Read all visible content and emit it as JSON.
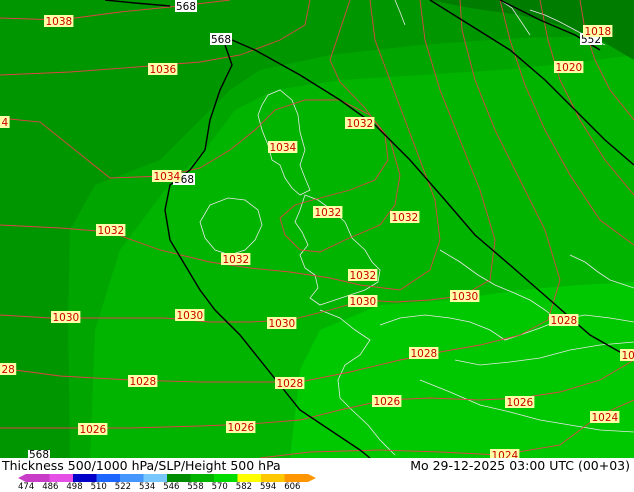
{
  "footer": {
    "title_left": "Thickness 500/1000 hPa/SLP/Height 500 hPa",
    "title_right": "Mo 29-12-2025 03:00 UTC (00+03)",
    "scale_ticks": [
      "474",
      "486",
      "498",
      "510",
      "522",
      "534",
      "546",
      "558",
      "570",
      "582",
      "594",
      "606"
    ],
    "scale_colors": [
      "#c83cc8",
      "#e650e6",
      "#0000c8",
      "#1e64ff",
      "#4696ff",
      "#78c8ff",
      "#008c00",
      "#00b400",
      "#00dc00",
      "#ffff00",
      "#ffc800",
      "#ff9600"
    ]
  },
  "colors": {
    "fill_dark": "#009600",
    "fill_mid": "#00a500",
    "fill_light": "#00b400",
    "fill_bright": "#00c800",
    "fill_darkest": "#007d00",
    "isobar": "#dc4646",
    "coast": "#e8e8e8",
    "height_line": "#000000"
  },
  "pressure_labels": [
    {
      "name": "label-1038",
      "text": "1038"
    },
    {
      "name": "label-1036",
      "text": "1036"
    },
    {
      "name": "label-edge-left",
      "text": "4"
    },
    {
      "name": "label-1034-west",
      "text": "1034"
    },
    {
      "name": "label-1034-scotland",
      "text": "1034"
    },
    {
      "name": "label-1032-north",
      "text": "1032"
    },
    {
      "name": "label-1032-west",
      "text": "1032"
    },
    {
      "name": "label-1032-ireland",
      "text": "1032"
    },
    {
      "name": "label-1032-england",
      "text": "1032"
    },
    {
      "name": "label-1032-northsea",
      "text": "1032"
    },
    {
      "name": "label-1032-south",
      "text": "1032"
    },
    {
      "name": "label-1030-west",
      "text": "1030"
    },
    {
      "name": "label-1030-ireland",
      "text": "1030"
    },
    {
      "name": "label-1030-channel",
      "text": "1030"
    },
    {
      "name": "label-1030-england",
      "text": "1030"
    },
    {
      "name": "label-1030-east",
      "text": "1030"
    },
    {
      "name": "label-1028-edge",
      "text": "28"
    },
    {
      "name": "label-1028-west",
      "text": "1028"
    },
    {
      "name": "label-1028-biscay",
      "text": "1028"
    },
    {
      "name": "label-1028-france",
      "text": "1028"
    },
    {
      "name": "label-1028-benelux",
      "text": "1028"
    },
    {
      "name": "label-1028-edge-right",
      "text": "10"
    },
    {
      "name": "label-1026-sw",
      "text": "1026"
    },
    {
      "name": "label-1026-s",
      "text": "1026"
    },
    {
      "name": "label-1026-france",
      "text": "1026"
    },
    {
      "name": "label-1026-east",
      "text": "1026"
    },
    {
      "name": "label-1024-se",
      "text": "1024"
    },
    {
      "name": "label-1024-bottom",
      "text": "1024"
    },
    {
      "name": "label-1020",
      "text": "1020"
    },
    {
      "name": "label-1018",
      "text": "1018"
    }
  ],
  "height_labels": [
    {
      "name": "height-568-top",
      "text": "568"
    },
    {
      "name": "height-568-mid",
      "text": "568"
    },
    {
      "name": "height-568-west",
      "text": "568"
    },
    {
      "name": "height-552",
      "text": "552"
    },
    {
      "name": "height-bottom",
      "text": "568"
    }
  ]
}
